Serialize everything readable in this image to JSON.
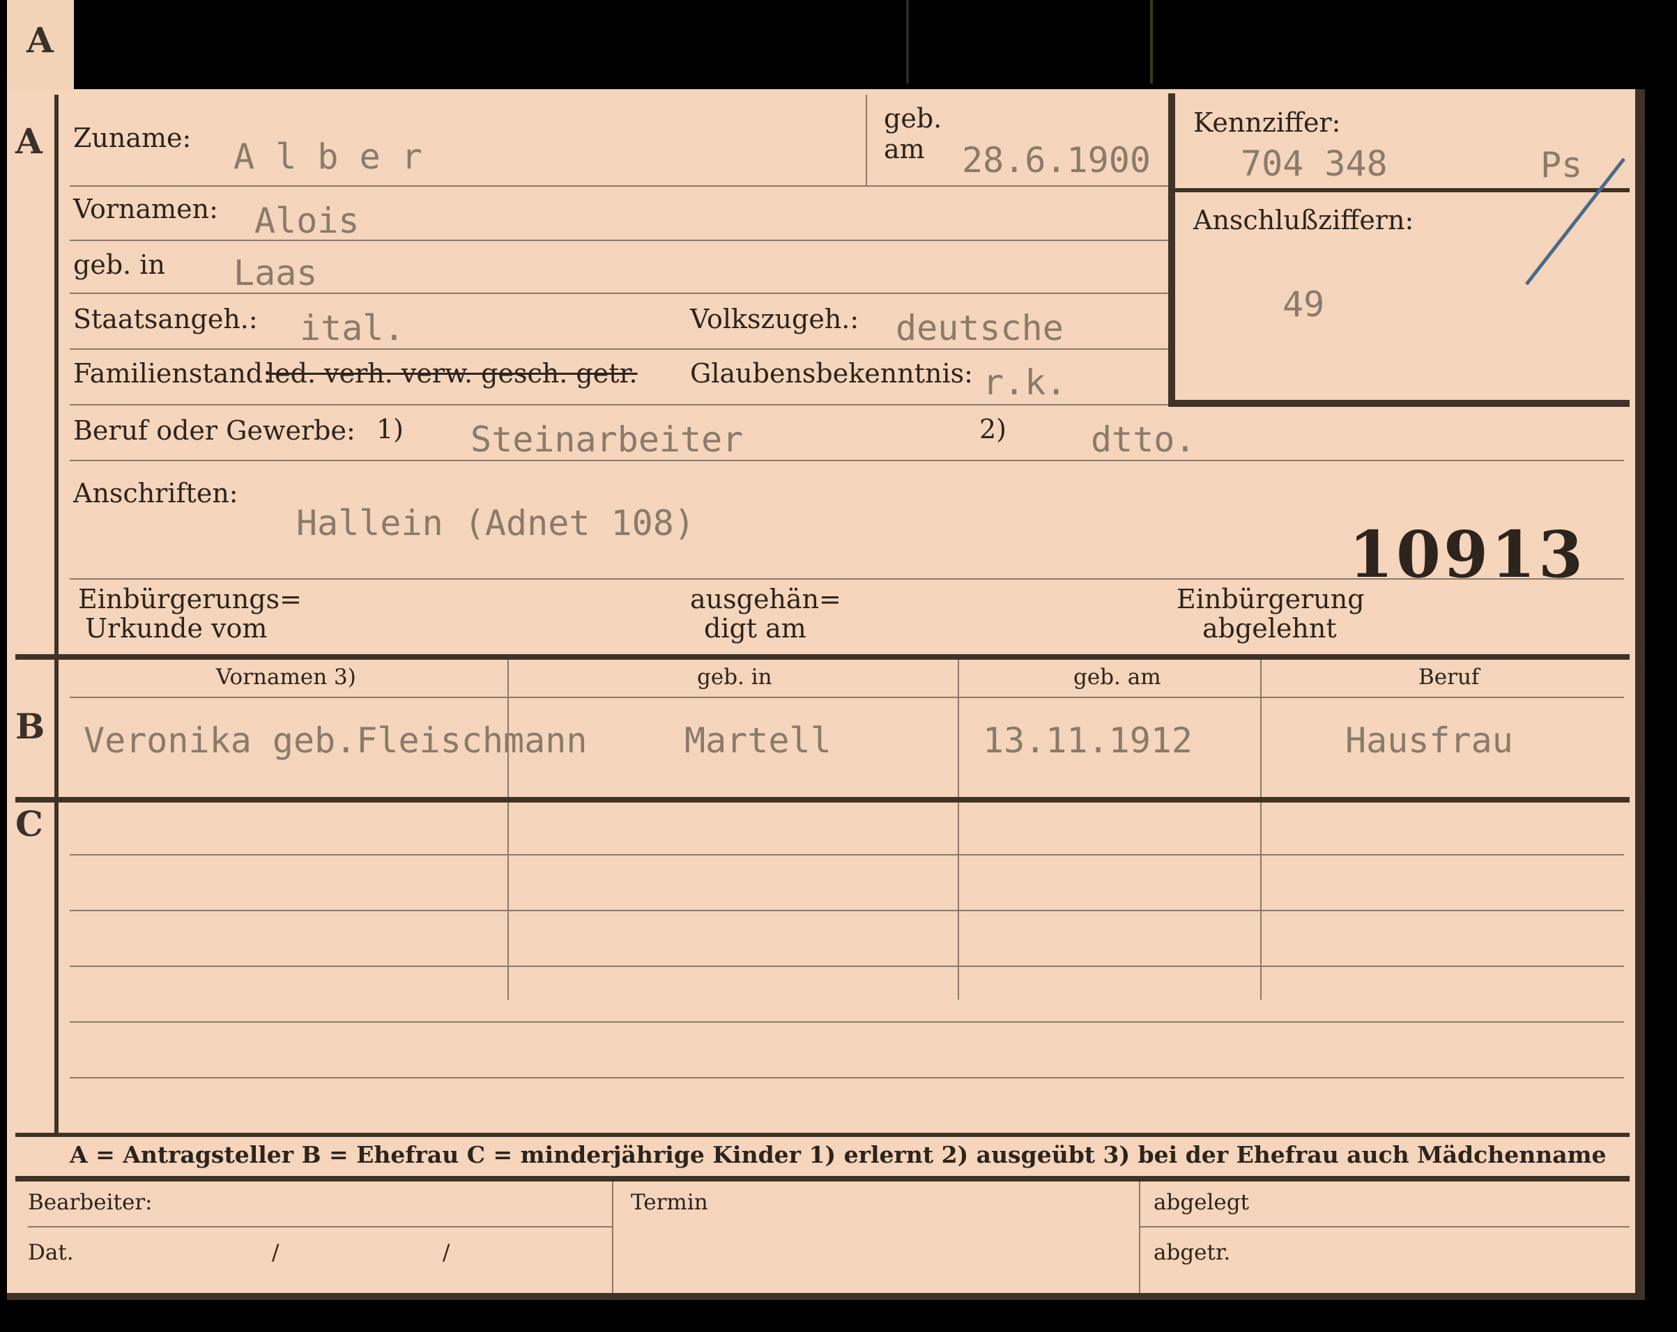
{
  "section_letters": {
    "a": "A",
    "b": "B",
    "c": "C"
  },
  "top": {
    "zuname_label": "Zuname:",
    "zuname_value": "A l b e r",
    "geb_am_label_1": "geb.",
    "geb_am_label_2": "am",
    "geb_am_value": "28.6.1900",
    "kennziffer_label": "Kennziffer:",
    "kennziffer_value": "704 348",
    "kennziffer_suffix": "Ps",
    "anschluss_label": "Anschlußziffern:",
    "anschluss_value": "49",
    "vornamen_label": "Vornamen:",
    "vornamen_value": "Alois",
    "geb_in_label": "geb. in",
    "geb_in_value": "Laas",
    "staatsangeh_label": "Staatsangeh.:",
    "staatsangeh_value": "ital.",
    "volkszugeh_label": "Volkszugeh.:",
    "volkszugeh_value": "deutsche",
    "familienstand_label": "Familienstand:",
    "familienstand_options": "led. verh. verw. gesch. getr.",
    "glauben_label": "Glaubensbekenntnis:",
    "glauben_value": "r.k.",
    "beruf_label": "Beruf oder Gewerbe:",
    "beruf_note1": "1)",
    "beruf_value1": "Steinarbeiter",
    "beruf_note2": "2)",
    "beruf_value2": "dtto.",
    "anschriften_label": "Anschriften:",
    "anschriften_value": "Hallein (Adnet 108)",
    "stamp_number": "10913",
    "einbuerg_label_1": "Einbürgerungs=",
    "einbuerg_label_2": "Urkunde vom",
    "ausgehaen_label_1": "ausgehän=",
    "ausgehaen_label_2": "digt am",
    "abgelehnt_label_1": "Einbürgerung",
    "abgelehnt_label_2": "abgelehnt"
  },
  "table": {
    "headers": [
      "Vornamen 3)",
      "geb. in",
      "geb. am",
      "Beruf"
    ],
    "wife": [
      "Veronika geb.Fleischmann",
      "Martell",
      "13.11.1912",
      "Hausfrau"
    ]
  },
  "footnote": "A = Antragsteller   B = Ehefrau   C = minderjährige Kinder   1) erlernt   2) ausgeübt   3) bei der Ehefrau auch Mädchenname",
  "bottom": {
    "bearbeiter_label": "Bearbeiter:",
    "termin_label": "Termin",
    "abgelegt_label": "abgelegt",
    "dat_label": "Dat.",
    "dat_sep1": "/",
    "dat_sep2": "/",
    "abgetr_label": "abgetr."
  },
  "colors": {
    "card": "#f5d5bb",
    "rule": "#8c7a69",
    "border": "#3f3328",
    "typed": "#8a7b6c",
    "pen": "#4a6a8a"
  }
}
